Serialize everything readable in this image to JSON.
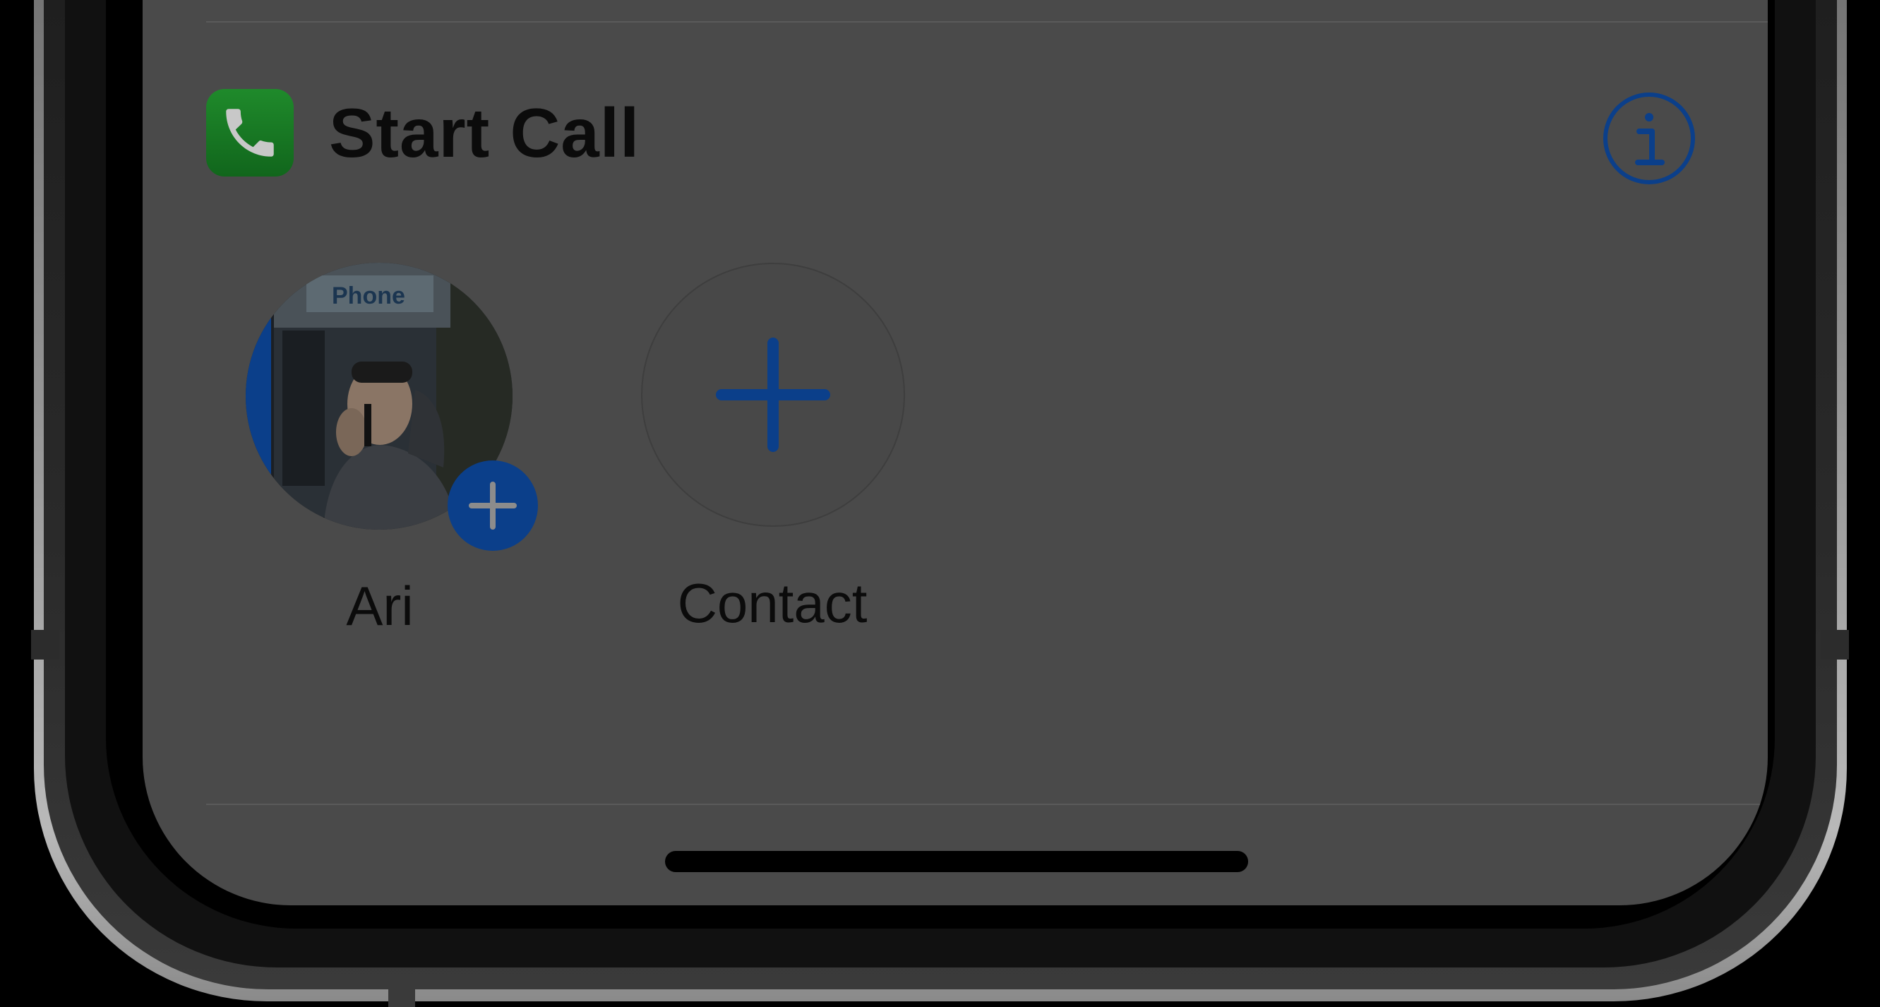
{
  "card": {
    "title": "Start Call",
    "app_icon": "phone-app-icon",
    "info_icon": "info-icon"
  },
  "contacts": [
    {
      "label": "Ari",
      "icon": "avatar-photo",
      "badge_icon": "plus-icon"
    },
    {
      "label": "Contact",
      "icon": "plus-icon"
    }
  ],
  "avatar_sign_text": "Phone",
  "colors": {
    "screen_background": "#4a4a4a",
    "accent_blue": "#0b3f8a",
    "phone_green": "#1f8a2b",
    "text": "#0b0b0b"
  }
}
